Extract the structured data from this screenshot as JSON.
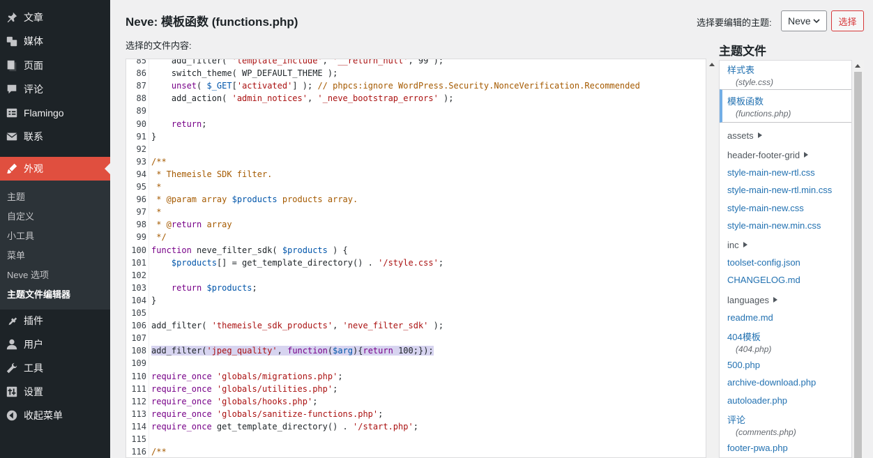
{
  "sidebar": {
    "items": [
      {
        "label": "文章",
        "icon": "pin-icon"
      },
      {
        "label": "媒体",
        "icon": "media-icon"
      },
      {
        "label": "页面",
        "icon": "page-icon"
      },
      {
        "label": "评论",
        "icon": "comment-icon"
      },
      {
        "label": "Flamingo",
        "icon": "flamingo-icon"
      },
      {
        "label": "联系",
        "icon": "mail-icon"
      },
      {
        "label": "外观",
        "icon": "brush-icon"
      },
      {
        "label": "插件",
        "icon": "plugin-icon"
      },
      {
        "label": "用户",
        "icon": "user-icon"
      },
      {
        "label": "工具",
        "icon": "wrench-icon"
      },
      {
        "label": "设置",
        "icon": "settings-icon"
      },
      {
        "label": "收起菜单",
        "icon": "collapse-icon"
      }
    ],
    "submenu": [
      "主题",
      "自定义",
      "小工具",
      "菜单",
      "Neve 选项",
      "主题文件编辑器"
    ]
  },
  "header": {
    "title": "Neve: 模板函数 (functions.php)",
    "select_label": "选择要编辑的主题:",
    "selected_theme": "Neve",
    "select_button": "选择",
    "content_label": "选择的文件内容:"
  },
  "code": [
    {
      "n": "85",
      "t": "    add_filter( 'template_include', '__return_null', 99 );"
    },
    {
      "n": "86",
      "t": "    switch_theme( WP_DEFAULT_THEME );"
    },
    {
      "n": "87",
      "t": "    unset( $_GET['activated'] ); // phpcs:ignore WordPress.Security.NonceVerification.Recommended"
    },
    {
      "n": "88",
      "t": "    add_action( 'admin_notices', '_neve_bootstrap_errors' );"
    },
    {
      "n": "89",
      "t": ""
    },
    {
      "n": "90",
      "t": "    return;"
    },
    {
      "n": "91",
      "t": "}"
    },
    {
      "n": "92",
      "t": ""
    },
    {
      "n": "93",
      "t": "/**"
    },
    {
      "n": "94",
      "t": " * Themeisle SDK filter."
    },
    {
      "n": "95",
      "t": " *"
    },
    {
      "n": "96",
      "t": " * @param array $products products array."
    },
    {
      "n": "97",
      "t": " *"
    },
    {
      "n": "98",
      "t": " * @return array"
    },
    {
      "n": "99",
      "t": " */"
    },
    {
      "n": "100",
      "t": "function neve_filter_sdk( $products ) {"
    },
    {
      "n": "101",
      "t": "    $products[] = get_template_directory() . '/style.css';"
    },
    {
      "n": "102",
      "t": ""
    },
    {
      "n": "103",
      "t": "    return $products;"
    },
    {
      "n": "104",
      "t": "}"
    },
    {
      "n": "105",
      "t": ""
    },
    {
      "n": "106",
      "t": "add_filter( 'themeisle_sdk_products', 'neve_filter_sdk' );"
    },
    {
      "n": "107",
      "t": ""
    },
    {
      "n": "108",
      "t": "add_filter('jpeg_quality', function($arg){return 100;});"
    },
    {
      "n": "109",
      "t": ""
    },
    {
      "n": "110",
      "t": "require_once 'globals/migrations.php';"
    },
    {
      "n": "111",
      "t": "require_once 'globals/utilities.php';"
    },
    {
      "n": "112",
      "t": "require_once 'globals/hooks.php';"
    },
    {
      "n": "113",
      "t": "require_once 'globals/sanitize-functions.php';"
    },
    {
      "n": "114",
      "t": "require_once get_template_directory() . '/start.php';"
    },
    {
      "n": "115",
      "t": ""
    },
    {
      "n": "116",
      "t": "/**"
    }
  ],
  "files": {
    "heading": "主题文件",
    "entries": [
      {
        "kind": "file",
        "name": "样式表",
        "sub": "(style.css)"
      },
      {
        "kind": "file",
        "name": "模板函数",
        "sub": "(functions.php)",
        "current": true
      },
      {
        "kind": "folder",
        "name": "assets"
      },
      {
        "kind": "folder",
        "name": "header-footer-grid"
      },
      {
        "kind": "file",
        "name": "style-main-new-rtl.css"
      },
      {
        "kind": "file",
        "name": "style-main-new-rtl.min.css"
      },
      {
        "kind": "file",
        "name": "style-main-new.css"
      },
      {
        "kind": "file",
        "name": "style-main-new.min.css"
      },
      {
        "kind": "folder",
        "name": "inc"
      },
      {
        "kind": "file",
        "name": "toolset-config.json"
      },
      {
        "kind": "file",
        "name": "CHANGELOG.md"
      },
      {
        "kind": "folder",
        "name": "languages"
      },
      {
        "kind": "file",
        "name": "readme.md"
      },
      {
        "kind": "file",
        "name": "404模板",
        "sub": "(404.php)"
      },
      {
        "kind": "file",
        "name": "500.php"
      },
      {
        "kind": "file",
        "name": "archive-download.php"
      },
      {
        "kind": "file",
        "name": "autoloader.php"
      },
      {
        "kind": "file",
        "name": "评论",
        "sub": "(comments.php)"
      },
      {
        "kind": "file",
        "name": "footer-pwa.php"
      }
    ]
  },
  "colors": {
    "sidebar_bg": "#1d2327",
    "active_menu": "#e04f3f",
    "link": "#2271b1"
  }
}
